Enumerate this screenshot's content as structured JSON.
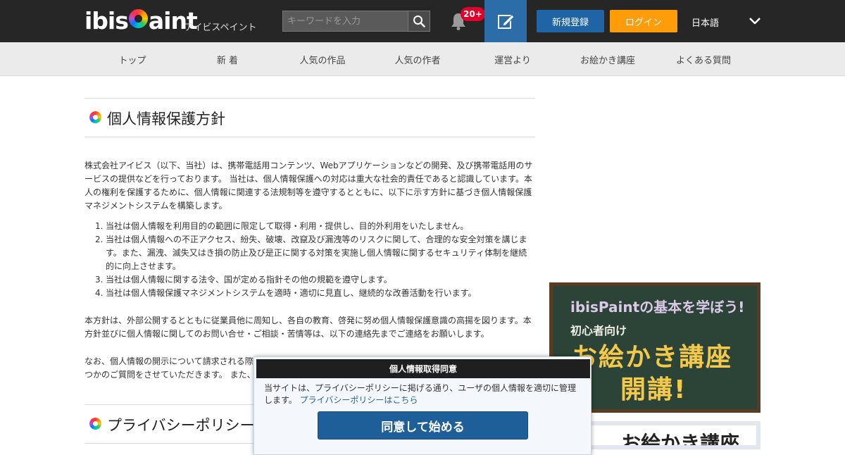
{
  "header": {
    "logo_text_left": "ibis",
    "logo_text_right": "aint",
    "logo_sub": "アイビスペイント",
    "search_placeholder": "キーワードを入力",
    "notification_count": "20+",
    "register_label": "新規登録",
    "login_label": "ログイン",
    "language": "日本語"
  },
  "nav": {
    "items": [
      {
        "label": "トップ"
      },
      {
        "label": "新 着"
      },
      {
        "label": "人気の作品"
      },
      {
        "label": "人気の作者"
      },
      {
        "label": "運営より"
      },
      {
        "label": "お絵かき講座"
      },
      {
        "label": "よくある質問"
      }
    ]
  },
  "main": {
    "heading1": "個人情報保護方針",
    "intro": "株式会社アイビス（以下、当社）は、携帯電話用コンテンツ、Webアプリケーションなどの開発、及び携帯電話用のサービスの提供などを行っております。 当社は、個人情報保護への対応は重大な社会的責任であると認識しています。本人の権利を保護するために、個人情報に関連する法規制等を遵守するとともに、以下に示す方針に基づき個人情報保護マネジメントシステムを構築します。",
    "policies": [
      {
        "num": "1.",
        "text": "当社は個人情報を利用目的の範囲に限定して取得・利用・提供し、目的外利用をいたしません。"
      },
      {
        "num": "2.",
        "text": "当社は個人情報への不正アクセス、紛失、破壊、改竄及び漏洩等のリスクに関して、合理的な安全対策を講じます。また、漏洩、滅失又はき損の防止及び是正に関する対策を実施し個人情報に関するセキュリティ体制を継続的に向上させます。"
      },
      {
        "num": "3.",
        "text": "当社は個人情報に関する法令、国が定める指針その他の規範を遵守します。"
      },
      {
        "num": "4.",
        "text": "当社は個人情報保護マネジメントシステムを適時・適切に見直し、継続的な改善活動を行います。"
      }
    ],
    "para2": "本方針は、外部公開するとともに従業員他に周知し、各自の教育、啓発に努め個人情報保護意識の高揚を図ります。本方針並びに個人情報に関してのお問い合せ・ご相談・苦情等は、以下の連絡先までご連絡をお願いします。",
    "para3_line1": "なお、個人情報の開示について請求される際",
    "para3_line2": "つかのご質問をさせていただきます。 また、",
    "heading2": "プライバシーポリシー"
  },
  "sidebar": {
    "banner1_line1": "ibisPaintの基本を学ぼう!",
    "banner1_line2": "初心者向け",
    "banner1_line3": "お絵かき講座",
    "banner1_line4": "開講!",
    "banner2_text": "お絵かき講座"
  },
  "consent": {
    "title": "個人情報取得同意",
    "text": "当サイトは、プライバシーポリシーに掲げる通り、ユーザの個人情報を適切に管理します。",
    "link": "プライバシーポリシーはこちら",
    "agree_label": "同意して始める"
  },
  "colors": {
    "header_bg": "#262626",
    "register": "#1f64a4",
    "login": "#ff9c0a",
    "badge": "#e0002a",
    "agree": "#1f5f99"
  }
}
